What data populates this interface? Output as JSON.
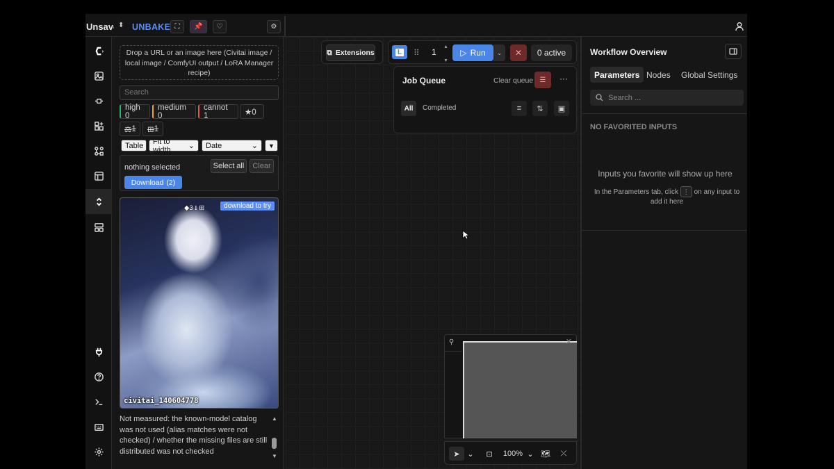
{
  "topbar": {
    "title": "Unsaved",
    "brand": "UNBAKE"
  },
  "panel": {
    "drop_hint": "Drop a URL or an image here (Civitai image / local image / ComfyUI output / LoRA Manager recipe)",
    "search_placeholder": "Search",
    "chips": {
      "high": "high 0",
      "medium": "medium 0",
      "cannot": "cannot 1",
      "star": "★0",
      "ws1": "1",
      "ws2": "1"
    },
    "view_select": "Table",
    "fit_select": "Fit to width",
    "sort_select": "Date",
    "selection_text": "nothing selected",
    "select_all": "Select all",
    "clear": "Clear",
    "download": "Download",
    "download_count": "(2)",
    "card": {
      "tag": "download to try",
      "badge": "3",
      "name": "civitai_140604778"
    },
    "note": "Not measured: the known-model catalog was not used (alias matches were not checked) / whether the missing files are still distributed was not checked"
  },
  "canvas": {
    "extensions": "Extensions",
    "logo_letter": "L",
    "batch_count": "1",
    "run": "Run",
    "active": "0 active",
    "queue": {
      "title": "Job Queue",
      "clear": "Clear queue",
      "tab_all": "All",
      "tab_completed": "Completed"
    },
    "zoom": "100%"
  },
  "rpanel": {
    "title": "Workflow Overview",
    "tabs": [
      "Parameters",
      "Nodes",
      "Global Settings"
    ],
    "search_placeholder": "Search ...",
    "heading": "NO FAVORITED INPUTS",
    "empty_title": "Inputs you favorite will show up here",
    "hint_before": "In the Parameters tab, click",
    "hint_after": "on any input to add it here"
  },
  "colors": {
    "accent": "#4a86e8",
    "brand": "#5b8ef0",
    "danger": "#6e2a2a",
    "high": "#2fb56a",
    "medium": "#e7a43b",
    "cannot": "#e65a4a"
  }
}
